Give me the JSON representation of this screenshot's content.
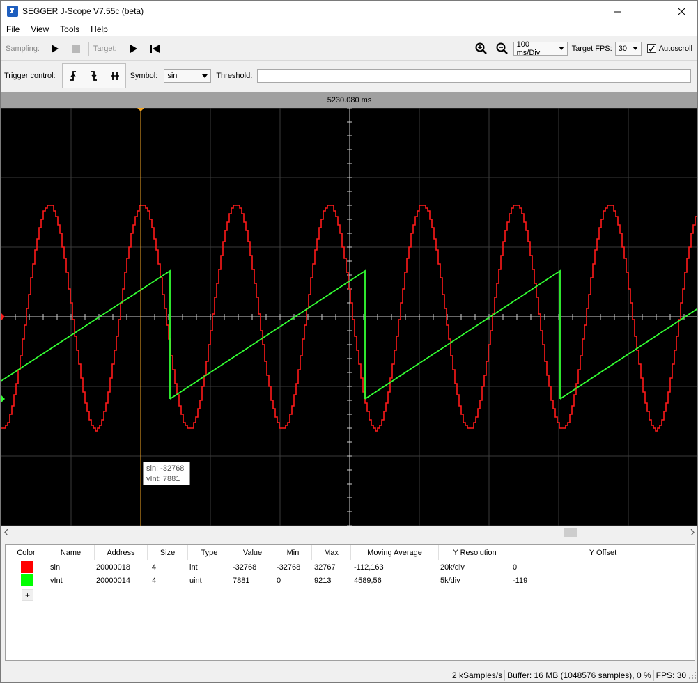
{
  "window": {
    "title": "SEGGER J-Scope V7.55c (beta)"
  },
  "menu": [
    "File",
    "View",
    "Tools",
    "Help"
  ],
  "toolbar": {
    "sampling_label": "Sampling:",
    "target_label": "Target:",
    "time_div": "100 ms/Div",
    "target_fps_label": "Target FPS:",
    "target_fps": "30",
    "autoscroll_label": "Autoscroll",
    "autoscroll_checked": true
  },
  "trigger": {
    "label": "Trigger control:",
    "symbol_label": "Symbol:",
    "symbol_value": "sin",
    "threshold_label": "Threshold:",
    "threshold_value": ""
  },
  "plot": {
    "time_readout": "5230.080 ms",
    "tooltip_line1": "sin: -32768",
    "tooltip_line2": "vInt: 7881",
    "colors": {
      "sin": "#ff1a1a",
      "vInt": "#33ff33",
      "cursor": "#f5a623"
    }
  },
  "table": {
    "headers": [
      "Color",
      "Name",
      "Address",
      "Size",
      "Type",
      "Value",
      "Min",
      "Max",
      "Moving Average",
      "Y Resolution",
      "Y Offset"
    ],
    "rows": [
      {
        "color": "#ff0000",
        "name": "sin",
        "address": "20000018",
        "size": "4",
        "type": "int",
        "value": "-32768",
        "min": "-32768",
        "max": "32767",
        "avg": "-112,163",
        "yres": "20k/div",
        "yoff": "0"
      },
      {
        "color": "#00ff00",
        "name": "vInt",
        "address": "20000014",
        "size": "4",
        "type": "uint",
        "value": "7881",
        "min": "0",
        "max": "9213",
        "avg": "4589,56",
        "yres": "5k/div",
        "yoff": "-119"
      }
    ],
    "add_label": "+"
  },
  "status": {
    "rate": "2 kSamples/s",
    "buffer": "Buffer: 16 MB (1048576 samples), 0 %",
    "fps": "FPS: 30"
  }
}
